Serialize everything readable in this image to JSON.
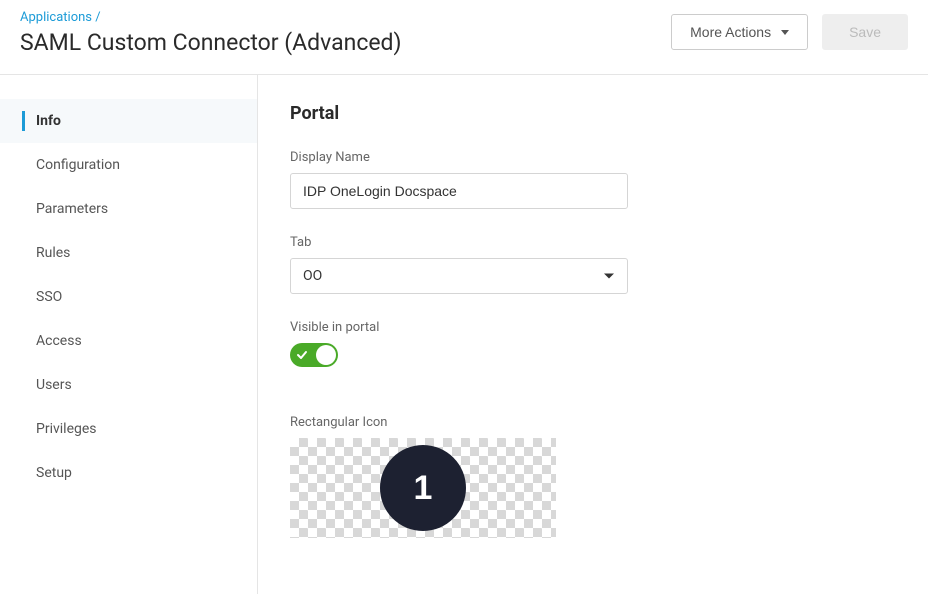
{
  "breadcrumb": {
    "parent": "Applications",
    "separator": "/"
  },
  "page_title": "SAML Custom Connector (Advanced)",
  "header_actions": {
    "more_label": "More Actions",
    "save_label": "Save"
  },
  "sidebar": {
    "items": [
      {
        "label": "Info",
        "active": true
      },
      {
        "label": "Configuration",
        "active": false
      },
      {
        "label": "Parameters",
        "active": false
      },
      {
        "label": "Rules",
        "active": false
      },
      {
        "label": "SSO",
        "active": false
      },
      {
        "label": "Access",
        "active": false
      },
      {
        "label": "Users",
        "active": false
      },
      {
        "label": "Privileges",
        "active": false
      },
      {
        "label": "Setup",
        "active": false
      }
    ]
  },
  "main": {
    "section_title": "Portal",
    "display_name": {
      "label": "Display Name",
      "value": "IDP OneLogin Docspace"
    },
    "tab": {
      "label": "Tab",
      "value": "OO"
    },
    "visible": {
      "label": "Visible in portal",
      "on": true
    },
    "rect_icon": {
      "label": "Rectangular Icon",
      "glyph": "1"
    }
  }
}
